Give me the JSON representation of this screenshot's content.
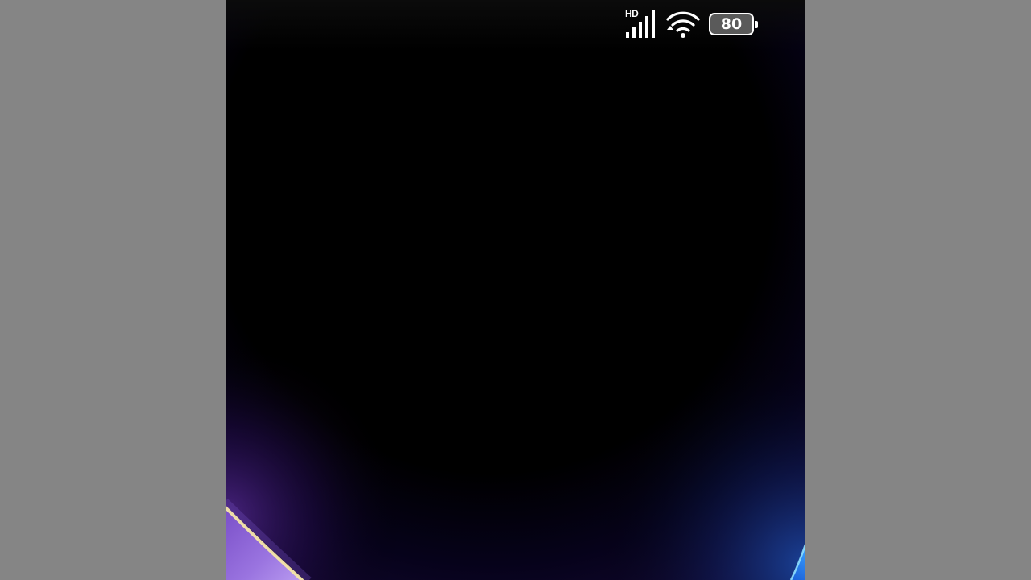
{
  "status_bar": {
    "network_type": "HD",
    "signal_icon": "cell-signal-icon",
    "wifi_icon": "wifi-icon",
    "battery_level": "80",
    "battery_icon": "battery-icon"
  },
  "wallpaper": {
    "description_colors": {
      "background": "#000000",
      "left_glow": "#9b6bdc",
      "left_highlight": "#f5d98a",
      "right_glow": "#2a7fff",
      "side_bars": "#858585"
    }
  }
}
